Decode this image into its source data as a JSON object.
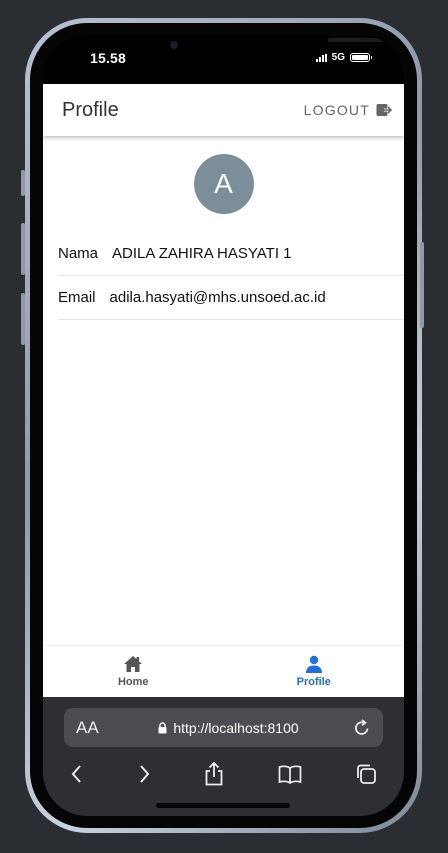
{
  "status_bar": {
    "time": "15.58",
    "network": "5G"
  },
  "header": {
    "title": "Profile",
    "logout_label": "LOGOUT"
  },
  "profile": {
    "avatar_letter": "A",
    "fields": [
      {
        "label": "Nama",
        "value": "ADILA ZAHIRA HASYATI 1"
      },
      {
        "label": "Email",
        "value": "adila.hasyati@mhs.unsoed.ac.id"
      }
    ]
  },
  "tabs": [
    {
      "label": "Home",
      "icon": "home-icon",
      "active": false
    },
    {
      "label": "Profile",
      "icon": "person-icon",
      "active": true
    }
  ],
  "browser": {
    "aa_label": "AA",
    "url": "http://localhost:8100"
  },
  "colors": {
    "active_tab": "#1f6fdd",
    "avatar": "#7b8f9b"
  }
}
